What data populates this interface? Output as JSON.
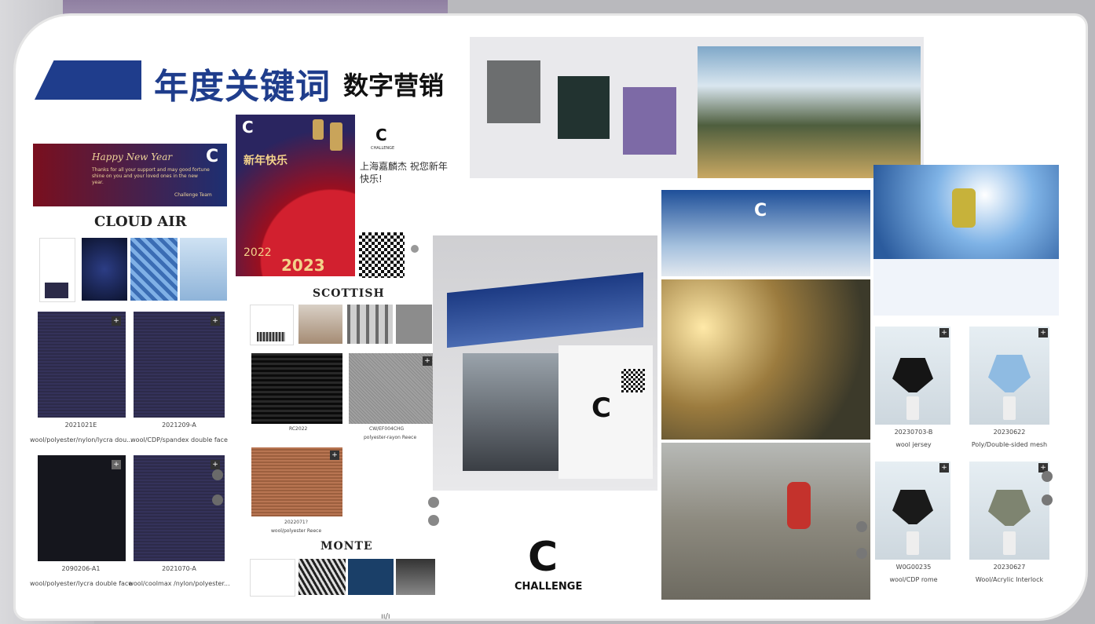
{
  "header": {
    "title": "年度关键词",
    "subtitle": "数字营销"
  },
  "newyear_banner": {
    "greeting": "Happy New Year",
    "message": "Thanks for all your support and may good fortune shine on you and your loved ones in the new year.",
    "signature": "Challenge Team"
  },
  "cloud_air": {
    "heading": "CLOUD AIR"
  },
  "poster": {
    "title": "新年快乐",
    "year1": "2022",
    "year2": "2023"
  },
  "wechat": {
    "brand": "CHALLENGE",
    "message": "上海嘉麟杰 祝您新年快乐!"
  },
  "scottish": {
    "heading": "SCOTTISH",
    "items": [
      {
        "code": "RC2022",
        "desc": ""
      },
      {
        "code": "CW/EF004CHG",
        "desc": "polyester-rayon Reece"
      },
      {
        "code": "2022071?",
        "desc": "wool/polyester Reece"
      }
    ]
  },
  "monte": {
    "heading": "MONTE"
  },
  "fabrics_left": [
    {
      "code": "2021021E",
      "desc": "wool/polyester/nylon/lycra dou..."
    },
    {
      "code": "2021209-A",
      "desc": "wool/CDP/spandex double face"
    },
    {
      "code": "2090206-A1",
      "desc": "wool/polyester/lycra double face"
    },
    {
      "code": "2021070-A",
      "desc": "wool/coolmax /nylon/polyester..."
    }
  ],
  "fabrics_right": [
    {
      "code": "20230703-B",
      "desc": "wool jersey"
    },
    {
      "code": "20230622",
      "desc": "Poly/Double-sided mesh"
    },
    {
      "code": "W0G00235",
      "desc": "wool/CDP rome"
    },
    {
      "code": "20230627",
      "desc": "Wool/Acrylic Interlock"
    }
  ],
  "brand_logo": {
    "letter": "C",
    "name": "CHALLENGE"
  },
  "footer_mark": "ıı/ı",
  "colors": {
    "navy": "#1f3d8c",
    "red": "#b2132a",
    "fabric": "#2d2b4a"
  }
}
